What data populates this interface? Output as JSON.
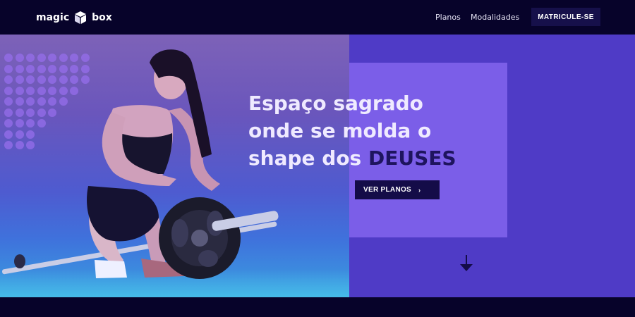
{
  "header": {
    "logo": {
      "text_left": "magic",
      "text_right": "box",
      "icon": "cube-icon"
    },
    "nav": [
      {
        "label": "Planos"
      },
      {
        "label": "Modalidades"
      }
    ],
    "cta_label": "MATRICULE-SE"
  },
  "hero": {
    "headline_line1": "Espaço sagrado",
    "headline_line2": "onde se molda o",
    "headline_line3_prefix": "shape dos ",
    "headline_accent": "DEUSES",
    "button_label": "VER PLANOS",
    "button_icon": "chevron-right-icon",
    "scroll_icon": "arrow-down-icon"
  },
  "colors": {
    "background": "#07032a",
    "hero_panel": "#4f3bc6",
    "accent_panel": "#7b5ee8",
    "button": "#140c48",
    "accent_text": "#1e145e"
  }
}
